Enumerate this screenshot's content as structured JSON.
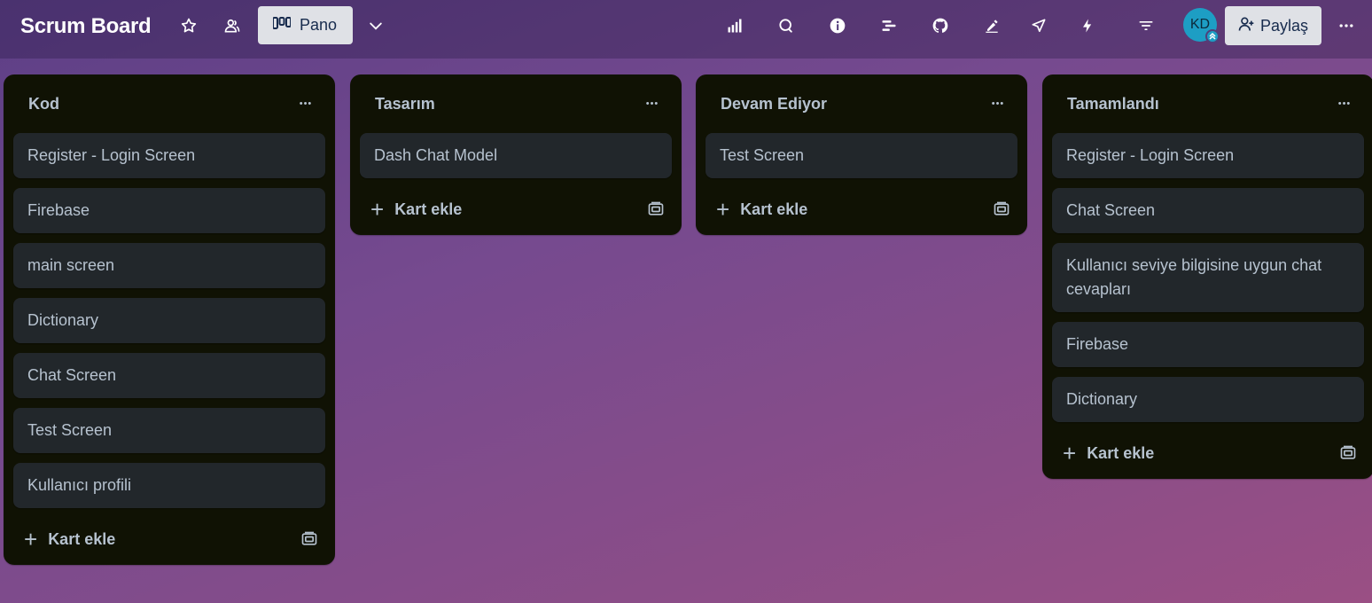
{
  "header": {
    "board_title": "Scrum Board",
    "view_label": "Pano",
    "share_label": "Paylaş",
    "avatar_initials": "KD",
    "icons": [
      "star-icon",
      "workspace-visibility-icon",
      "board-view-icon",
      "chevron-down-icon",
      "dashboard-icon",
      "butler-icon",
      "info-icon",
      "timeline-icon",
      "github-icon",
      "pin-icon",
      "rocket-icon",
      "automation-icon",
      "filter-icon",
      "more-icon"
    ]
  },
  "lists": [
    {
      "title": "Kod",
      "cards": [
        "Register - Login Screen",
        "Firebase",
        "main screen",
        "Dictionary",
        "Chat Screen",
        "Test Screen",
        "Kullanıcı profili"
      ],
      "add_label": "Kart ekle"
    },
    {
      "title": "Tasarım",
      "cards": [
        "Dash Chat Model"
      ],
      "add_label": "Kart ekle"
    },
    {
      "title": "Devam Ediyor",
      "cards": [
        "Test Screen"
      ],
      "add_label": "Kart ekle"
    },
    {
      "title": "Tamamlandı",
      "cards": [
        "Register - Login Screen",
        "Chat Screen",
        "Kullanıcı seviye bilgisine uygun chat cevapları",
        "Firebase",
        "Dictionary"
      ],
      "add_label": "Kart ekle"
    }
  ],
  "colors": {
    "list_bg": "#101204",
    "card_bg": "#22272b",
    "text": "#b6c2cf",
    "avatar": "#1d9ec4"
  }
}
